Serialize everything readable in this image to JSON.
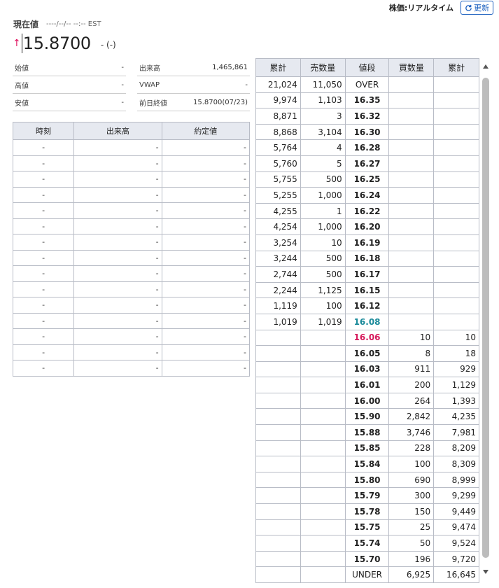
{
  "header": {
    "price_mode": "株価:リアルタイム",
    "refresh_label": "更新"
  },
  "quote": {
    "label": "現在値",
    "time": "----/--/-- --:-- EST",
    "arrow": "↑",
    "price": "15.8700",
    "change": "- (-)"
  },
  "info_left": [
    {
      "label": "始値",
      "value": "-"
    },
    {
      "label": "高値",
      "value": "-"
    },
    {
      "label": "安値",
      "value": "-"
    }
  ],
  "info_right": [
    {
      "label": "出来高",
      "value": "1,465,861"
    },
    {
      "label": "VWAP",
      "value": "-"
    },
    {
      "label": "前日終値",
      "value": "15.8700(07/23)"
    }
  ],
  "trades": {
    "headers": [
      "時刻",
      "出来高",
      "約定値"
    ],
    "rows": [
      [
        "-",
        "-",
        "-"
      ],
      [
        "-",
        "-",
        "-"
      ],
      [
        "-",
        "-",
        "-"
      ],
      [
        "-",
        "-",
        "-"
      ],
      [
        "-",
        "-",
        "-"
      ],
      [
        "-",
        "-",
        "-"
      ],
      [
        "-",
        "-",
        "-"
      ],
      [
        "-",
        "-",
        "-"
      ],
      [
        "-",
        "-",
        "-"
      ],
      [
        "-",
        "-",
        "-"
      ],
      [
        "-",
        "-",
        "-"
      ],
      [
        "-",
        "-",
        "-"
      ],
      [
        "-",
        "-",
        "-"
      ],
      [
        "-",
        "-",
        "-"
      ],
      [
        "-",
        "-",
        "-"
      ]
    ]
  },
  "board": {
    "headers": [
      "累計",
      "売数量",
      "値段",
      "買数量",
      "累計"
    ],
    "rows": [
      [
        "21,024",
        "11,050",
        "OVER",
        "",
        ""
      ],
      [
        "9,974",
        "1,103",
        "16.35",
        "",
        ""
      ],
      [
        "8,871",
        "3",
        "16.32",
        "",
        ""
      ],
      [
        "8,868",
        "3,104",
        "16.30",
        "",
        ""
      ],
      [
        "5,764",
        "4",
        "16.28",
        "",
        ""
      ],
      [
        "5,760",
        "5",
        "16.27",
        "",
        ""
      ],
      [
        "5,755",
        "500",
        "16.25",
        "",
        ""
      ],
      [
        "5,255",
        "1,000",
        "16.24",
        "",
        ""
      ],
      [
        "4,255",
        "1",
        "16.22",
        "",
        ""
      ],
      [
        "4,254",
        "1,000",
        "16.20",
        "",
        ""
      ],
      [
        "3,254",
        "10",
        "16.19",
        "",
        ""
      ],
      [
        "3,244",
        "500",
        "16.18",
        "",
        ""
      ],
      [
        "2,744",
        "500",
        "16.17",
        "",
        ""
      ],
      [
        "2,244",
        "1,125",
        "16.15",
        "",
        ""
      ],
      [
        "1,119",
        "100",
        "16.12",
        "",
        ""
      ],
      [
        "1,019",
        "1,019",
        "16.08",
        "",
        ""
      ],
      [
        "",
        "",
        "16.06",
        "10",
        "10"
      ],
      [
        "",
        "",
        "16.05",
        "8",
        "18"
      ],
      [
        "",
        "",
        "16.03",
        "911",
        "929"
      ],
      [
        "",
        "",
        "16.01",
        "200",
        "1,129"
      ],
      [
        "",
        "",
        "16.00",
        "264",
        "1,393"
      ],
      [
        "",
        "",
        "15.90",
        "2,842",
        "4,235"
      ],
      [
        "",
        "",
        "15.88",
        "3,746",
        "7,981"
      ],
      [
        "",
        "",
        "15.85",
        "228",
        "8,209"
      ],
      [
        "",
        "",
        "15.84",
        "100",
        "8,309"
      ],
      [
        "",
        "",
        "15.80",
        "690",
        "8,999"
      ],
      [
        "",
        "",
        "15.79",
        "300",
        "9,299"
      ],
      [
        "",
        "",
        "15.78",
        "150",
        "9,449"
      ],
      [
        "",
        "",
        "15.75",
        "25",
        "9,474"
      ],
      [
        "",
        "",
        "15.74",
        "50",
        "9,524"
      ],
      [
        "",
        "",
        "15.70",
        "196",
        "9,720"
      ],
      [
        "",
        "",
        "UNDER",
        "6,925",
        "16,645"
      ]
    ]
  },
  "colors": {
    "up_arrow": "#e0115f",
    "last_price": "#1a8a9a",
    "best_bid": "#d6195b",
    "button_blue": "#1a5fbf",
    "header_bg": "#e6e9f0"
  }
}
